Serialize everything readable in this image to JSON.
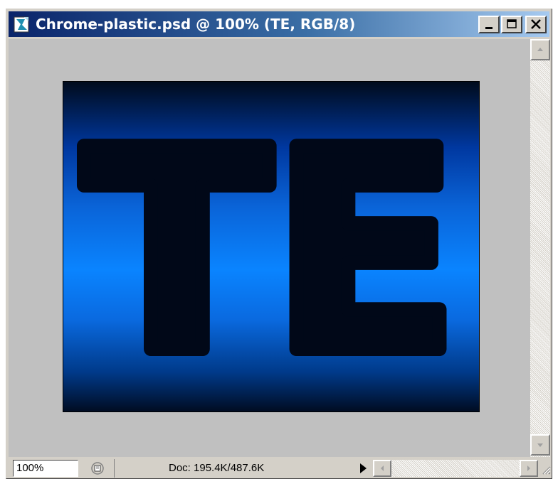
{
  "window": {
    "title": "Chrome-plastic.psd @ 100% (TE, RGB/8)",
    "app_icon": "photoshop-document-icon",
    "buttons": {
      "minimize": "minimize-icon",
      "maximize": "maximize-icon",
      "close": "close-icon"
    }
  },
  "document": {
    "text": "TE",
    "text_color": "#010818",
    "gradient_colors": [
      "#000b1c",
      "#0038a0",
      "#0a84ff",
      "#003a8a",
      "#000c22"
    ],
    "pasteboard_color": "#c0c0c0"
  },
  "status_bar": {
    "zoom": "100%",
    "doc_info": "Doc: 195.4K/487.6K",
    "preview_icon": "preview-icon",
    "menu_icon": "triangle-right-icon"
  },
  "scrollbars": {
    "up_icon": "arrow-up-icon",
    "down_icon": "arrow-down-icon",
    "left_icon": "arrow-left-icon",
    "right_icon": "arrow-right-icon"
  }
}
